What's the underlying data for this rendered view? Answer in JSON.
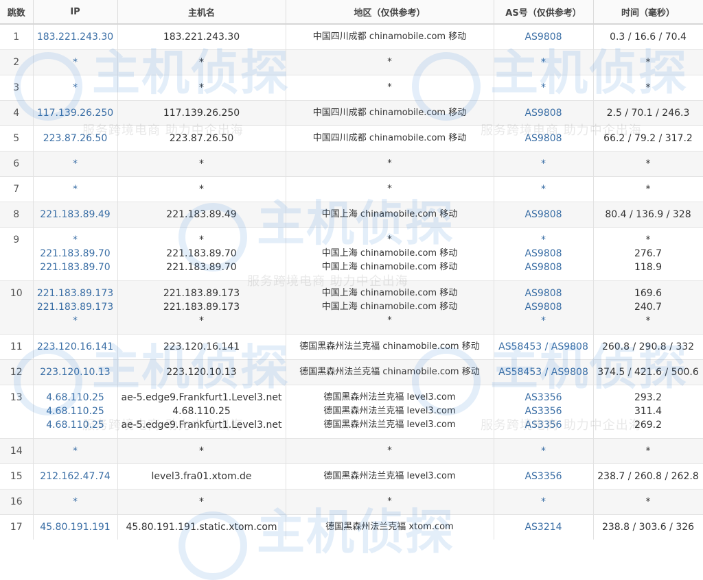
{
  "headers": [
    "跳数",
    "IP",
    "主机名",
    "地区（仅供参考）",
    "AS号（仅供参考）",
    "时间（毫秒）"
  ],
  "rows": [
    {
      "hop": "1",
      "ip": [
        "183.221.243.30"
      ],
      "host": [
        "183.221.243.30"
      ],
      "loc": [
        "中国四川成都 chinamobile.com 移动"
      ],
      "asn": [
        "AS9808"
      ],
      "time": [
        "0.3 / 16.6 / 70.4"
      ]
    },
    {
      "hop": "2",
      "ip": [
        "*"
      ],
      "host": [
        "*"
      ],
      "loc": [
        "*"
      ],
      "asn": [
        "*"
      ],
      "time": [
        "*"
      ]
    },
    {
      "hop": "3",
      "ip": [
        "*"
      ],
      "host": [
        "*"
      ],
      "loc": [
        "*"
      ],
      "asn": [
        "*"
      ],
      "time": [
        "*"
      ]
    },
    {
      "hop": "4",
      "ip": [
        "117.139.26.250"
      ],
      "host": [
        "117.139.26.250"
      ],
      "loc": [
        "中国四川成都 chinamobile.com 移动"
      ],
      "asn": [
        "AS9808"
      ],
      "time": [
        "2.5 / 70.1 / 246.3"
      ]
    },
    {
      "hop": "5",
      "ip": [
        "223.87.26.50"
      ],
      "host": [
        "223.87.26.50"
      ],
      "loc": [
        "中国四川成都 chinamobile.com 移动"
      ],
      "asn": [
        "AS9808"
      ],
      "time": [
        "66.2 / 79.2 / 317.2"
      ]
    },
    {
      "hop": "6",
      "ip": [
        "*"
      ],
      "host": [
        "*"
      ],
      "loc": [
        "*"
      ],
      "asn": [
        "*"
      ],
      "time": [
        "*"
      ]
    },
    {
      "hop": "7",
      "ip": [
        "*"
      ],
      "host": [
        "*"
      ],
      "loc": [
        "*"
      ],
      "asn": [
        "*"
      ],
      "time": [
        "*"
      ]
    },
    {
      "hop": "8",
      "ip": [
        "221.183.89.49"
      ],
      "host": [
        "221.183.89.49"
      ],
      "loc": [
        "中国上海 chinamobile.com 移动"
      ],
      "asn": [
        "AS9808"
      ],
      "time": [
        "80.4 / 136.9 / 328"
      ]
    },
    {
      "hop": "9",
      "ip": [
        "*",
        "221.183.89.70",
        "221.183.89.70"
      ],
      "host": [
        "*",
        "221.183.89.70",
        "221.183.89.70"
      ],
      "loc": [
        "*",
        "中国上海 chinamobile.com 移动",
        "中国上海 chinamobile.com 移动"
      ],
      "asn": [
        "*",
        "AS9808",
        "AS9808"
      ],
      "time": [
        "*",
        "276.7",
        "118.9"
      ]
    },
    {
      "hop": "10",
      "ip": [
        "221.183.89.173",
        "221.183.89.173",
        "*"
      ],
      "host": [
        "221.183.89.173",
        "221.183.89.173",
        "*"
      ],
      "loc": [
        "中国上海 chinamobile.com 移动",
        "中国上海 chinamobile.com 移动",
        "*"
      ],
      "asn": [
        "AS9808",
        "AS9808",
        "*"
      ],
      "time": [
        "169.6",
        "240.7",
        "*"
      ]
    },
    {
      "hop": "11",
      "ip": [
        "223.120.16.141"
      ],
      "host": [
        "223.120.16.141"
      ],
      "loc": [
        "德国黑森州法兰克福 chinamobile.com 移动"
      ],
      "asn": [
        "AS58453 / AS9808"
      ],
      "time": [
        "260.8 / 290.8 / 332"
      ]
    },
    {
      "hop": "12",
      "ip": [
        "223.120.10.13"
      ],
      "host": [
        "223.120.10.13"
      ],
      "loc": [
        "德国黑森州法兰克福 chinamobile.com 移动"
      ],
      "asn": [
        "AS58453 / AS9808"
      ],
      "time": [
        "374.5 / 421.6 / 500.6"
      ]
    },
    {
      "hop": "13",
      "ip": [
        "4.68.110.25",
        "4.68.110.25",
        "4.68.110.25"
      ],
      "host": [
        "ae-5.edge9.Frankfurt1.Level3.net",
        "4.68.110.25",
        "ae-5.edge9.Frankfurt1.Level3.net"
      ],
      "loc": [
        "德国黑森州法兰克福 level3.com",
        "德国黑森州法兰克福 level3.com",
        "德国黑森州法兰克福 level3.com"
      ],
      "asn": [
        "AS3356",
        "AS3356",
        "AS3356"
      ],
      "time": [
        "293.2",
        "311.4",
        "269.2"
      ]
    },
    {
      "hop": "14",
      "ip": [
        "*"
      ],
      "host": [
        "*"
      ],
      "loc": [
        "*"
      ],
      "asn": [
        "*"
      ],
      "time": [
        "*"
      ]
    },
    {
      "hop": "15",
      "ip": [
        "212.162.47.74"
      ],
      "host": [
        "level3.fra01.xtom.de"
      ],
      "loc": [
        "德国黑森州法兰克福 level3.com"
      ],
      "asn": [
        "AS3356"
      ],
      "time": [
        "238.7 / 260.8 / 262.8"
      ]
    },
    {
      "hop": "16",
      "ip": [
        "*"
      ],
      "host": [
        "*"
      ],
      "loc": [
        "*"
      ],
      "asn": [
        "*"
      ],
      "time": [
        "*"
      ]
    },
    {
      "hop": "17",
      "ip": [
        "45.80.191.191"
      ],
      "host": [
        "45.80.191.191.static.xtom.com"
      ],
      "loc": [
        "德国黑森州法兰克福 xtom.com"
      ],
      "asn": [
        "AS3214"
      ],
      "time": [
        "238.8 / 303.6 / 326"
      ]
    }
  ],
  "watermark": {
    "logo": "主机侦探",
    "slogan": "服务跨境电商 助力中企出海"
  },
  "colors": {
    "link": "#3a6ea5",
    "watermark": "#2f7fd8"
  }
}
